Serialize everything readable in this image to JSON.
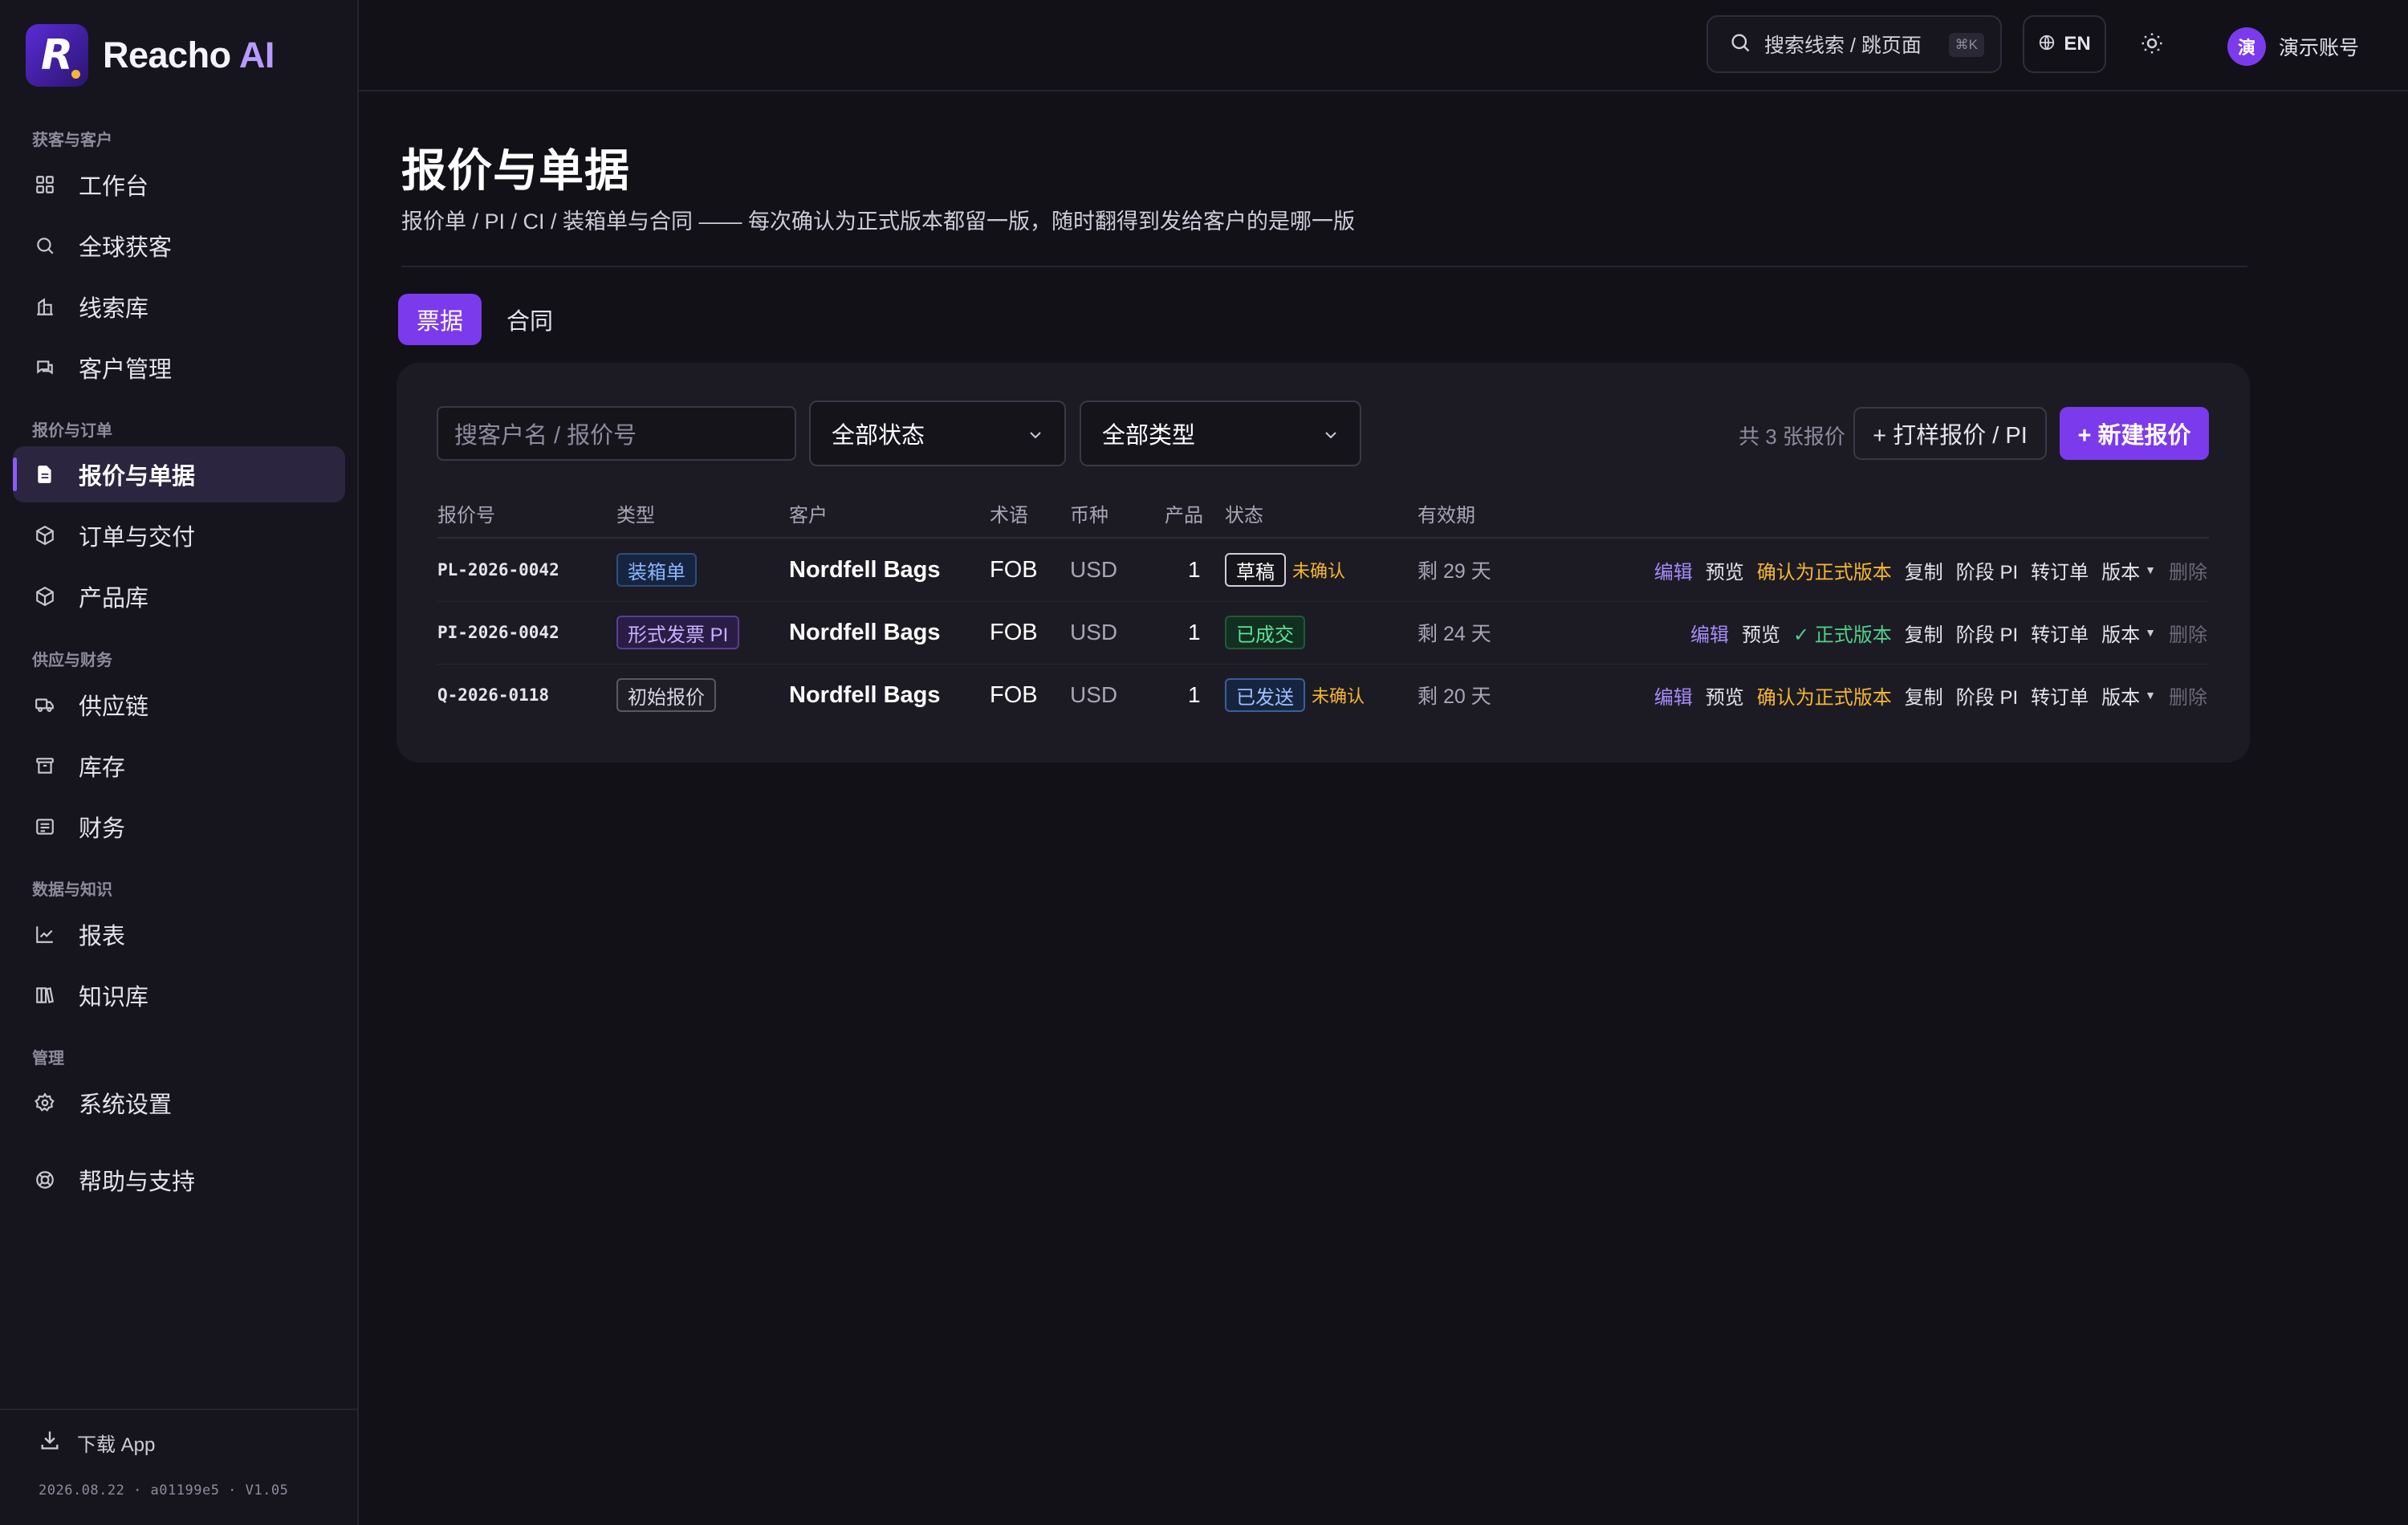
{
  "brand": {
    "logo_glyph": "R",
    "name": "Reacho",
    "suffix": "AI"
  },
  "sidebar": {
    "groups": [
      {
        "label": "获客与客户"
      },
      {
        "label": "报价与订单"
      },
      {
        "label": "供应与财务"
      },
      {
        "label": "数据与知识"
      },
      {
        "label": "管理"
      }
    ],
    "items": [
      {
        "label": "工作台",
        "icon": "grid-icon"
      },
      {
        "label": "全球获客",
        "icon": "search-icon"
      },
      {
        "label": "线索库",
        "icon": "building-icon"
      },
      {
        "label": "客户管理",
        "icon": "chat-icon"
      },
      {
        "label": "报价与单据",
        "icon": "document-icon",
        "active": true
      },
      {
        "label": "订单与交付",
        "icon": "box-icon"
      },
      {
        "label": "产品库",
        "icon": "cube-icon"
      },
      {
        "label": "供应链",
        "icon": "truck-icon"
      },
      {
        "label": "库存",
        "icon": "archive-icon"
      },
      {
        "label": "财务",
        "icon": "receipt-icon"
      },
      {
        "label": "报表",
        "icon": "chart-line-icon"
      },
      {
        "label": "知识库",
        "icon": "books-icon"
      },
      {
        "label": "系统设置",
        "icon": "gear-icon"
      },
      {
        "label": "帮助与支持",
        "icon": "lifebuoy-icon"
      }
    ],
    "download_label": "下载 App",
    "version": "2026.08.22 · a01199e5 · V1.05"
  },
  "topbar": {
    "search_placeholder": "搜索线索 / 跳页面",
    "search_shortcut": "⌘K",
    "lang": "EN",
    "avatar_char": "演",
    "account_name": "演示账号"
  },
  "page": {
    "title": "报价与单据",
    "subtitle": "报价单 / PI / CI / 装箱单与合同 —— 每次确认为正式版本都留一版，随时翻得到发给客户的是哪一版",
    "tabs": [
      {
        "label": "票据",
        "active": true
      },
      {
        "label": "合同",
        "active": false
      }
    ]
  },
  "filters": {
    "search_placeholder": "搜客户名 / 报价号",
    "status_value": "全部状态",
    "type_value": "全部类型",
    "count_text": "共 3 张报价",
    "sample_button": "+ 打样报价 / PI",
    "new_button": "+ 新建报价"
  },
  "table": {
    "headers": [
      "报价号",
      "类型",
      "客户",
      "术语",
      "币种",
      "产品",
      "状态",
      "有效期"
    ],
    "rows": [
      {
        "id": "PL-2026-0042",
        "type": "装箱单",
        "type_style": "blue",
        "customer": "Nordfell Bags",
        "term": "FOB",
        "currency": "USD",
        "products": "1",
        "status": "草稿",
        "status_style": "dark",
        "flag": "未确认",
        "validity": "剩 29 天",
        "actions": {
          "edit": "编辑",
          "preview": "预览",
          "confirm": "确认为正式版本",
          "copy": "复制",
          "stage": "阶段 PI",
          "convert": "转订单",
          "version": "版本",
          "delete": "删除"
        }
      },
      {
        "id": "PI-2026-0042",
        "type": "形式发票 PI",
        "type_style": "purple",
        "customer": "Nordfell Bags",
        "term": "FOB",
        "currency": "USD",
        "products": "1",
        "status": "已成交",
        "status_style": "green",
        "flag": "",
        "validity": "剩 24 天",
        "actions": {
          "edit": "编辑",
          "preview": "预览",
          "official": "✓ 正式版本",
          "copy": "复制",
          "stage": "阶段 PI",
          "convert": "转订单",
          "version": "版本",
          "delete": "删除"
        }
      },
      {
        "id": "Q-2026-0118",
        "type": "初始报价",
        "type_style": "gray",
        "customer": "Nordfell Bags",
        "term": "FOB",
        "currency": "USD",
        "products": "1",
        "status": "已发送",
        "status_style": "sent",
        "flag": "未确认",
        "validity": "剩 20 天",
        "actions": {
          "edit": "编辑",
          "preview": "预览",
          "confirm": "确认为正式版本",
          "copy": "复制",
          "stage": "阶段 PI",
          "convert": "转订单",
          "version": "版本",
          "delete": "删除"
        }
      }
    ]
  },
  "colors": {
    "accent": "#7c3aed",
    "warning": "#f5b731",
    "success": "#4fd18b",
    "background": "#121118"
  }
}
